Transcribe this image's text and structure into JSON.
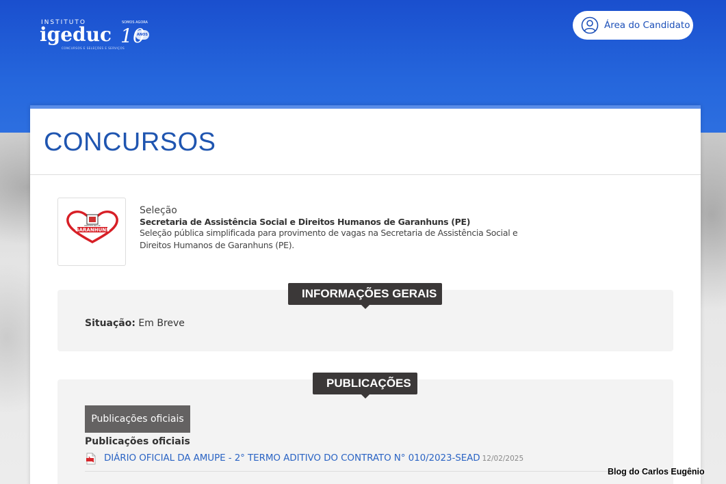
{
  "header": {
    "logo": {
      "top_text": "INSTITUTO",
      "name": "igeduc",
      "tagline": "CONCURSOS E SELEÇÕES E SERVIÇOS",
      "anniversary_number": "10",
      "anniversary_badge": "ANOS",
      "anniversary_prefix": "SOMOS AGORA"
    },
    "candidate_button_label": "Área do Candidato"
  },
  "page": {
    "title": "CONCURSOS"
  },
  "organization": {
    "logo_text": "GARANHUNS",
    "logo_subtext": "PREFEITURA DE",
    "kind": "Seleção",
    "name": "Secretaria de Assistência Social e Direitos Humanos de Garanhuns (PE)",
    "description": "Seleção pública simplificada para provimento de vagas na Secretaria de Assistência Social e Direitos Humanos de Garanhuns (PE)."
  },
  "general_info": {
    "label": "INFORMAÇÕES GERAIS",
    "status_label": "Situação:",
    "status_value": "Em Breve"
  },
  "publications": {
    "label": "PUBLICAÇÕES",
    "tab_label": "Publicações oficiais",
    "heading": "Publicações oficiais",
    "items": [
      {
        "title": "DIÁRIO OFICIAL DA AMUPE - 2° TERMO ADITIVO DO CONTRATO N° 010/2023-SEAD",
        "date": "12/02/2025"
      }
    ]
  },
  "watermark": "Blog do Carlos Eugênio",
  "colors": {
    "header_blue": "#1a4fce",
    "title_blue": "#1f55b0",
    "link_blue": "#2b64c4",
    "label_dark": "#3b3838",
    "tab_gray": "#646262"
  }
}
